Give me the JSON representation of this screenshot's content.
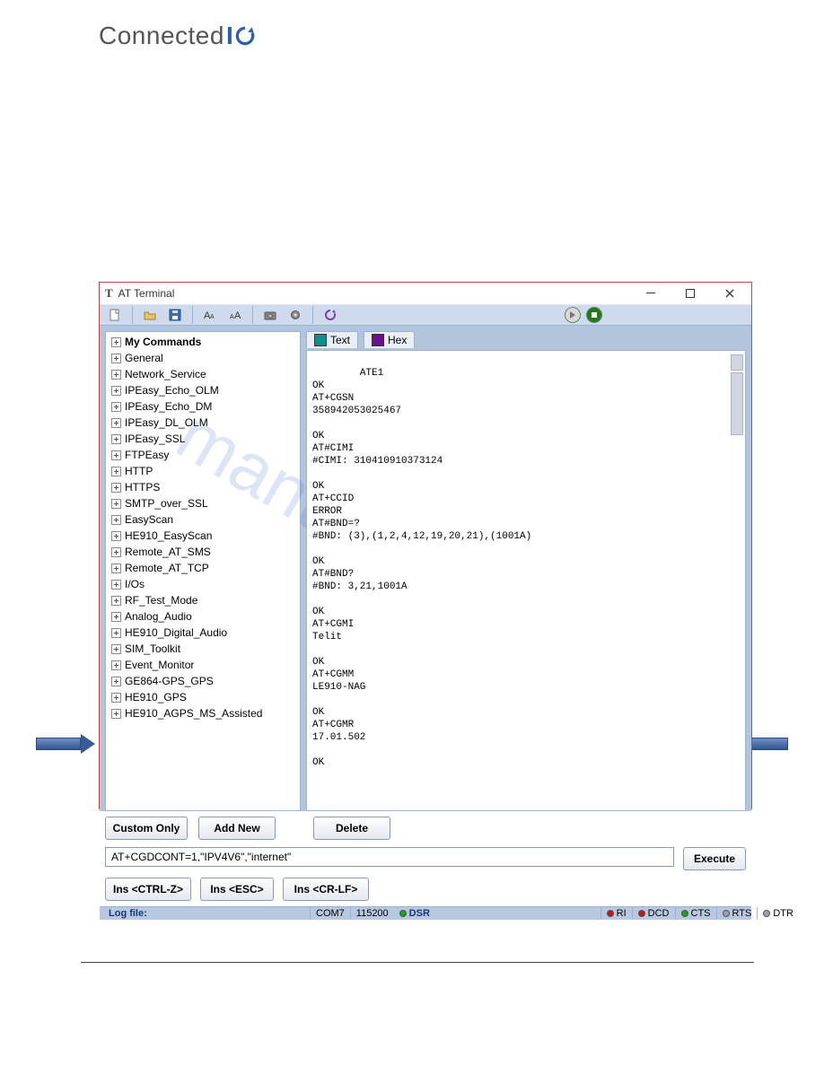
{
  "brand": {
    "text": "Connected",
    "accent": "IO"
  },
  "window": {
    "title": "AT Terminal"
  },
  "toolbar_icons": [
    "new-file-icon",
    "open-folder-icon",
    "save-icon",
    "font-larger-icon",
    "font-smaller-icon",
    "camera-icon",
    "gear-icon",
    "refresh-icon"
  ],
  "tree": [
    {
      "label": "My Commands",
      "bold": true
    },
    {
      "label": "General"
    },
    {
      "label": "Network_Service"
    },
    {
      "label": "IPEasy_Echo_OLM"
    },
    {
      "label": "IPEasy_Echo_DM"
    },
    {
      "label": "IPEasy_DL_OLM"
    },
    {
      "label": "IPEasy_SSL"
    },
    {
      "label": "FTPEasy"
    },
    {
      "label": "HTTP"
    },
    {
      "label": "HTTPS"
    },
    {
      "label": "SMTP_over_SSL"
    },
    {
      "label": "EasyScan"
    },
    {
      "label": "HE910_EasyScan"
    },
    {
      "label": "Remote_AT_SMS"
    },
    {
      "label": "Remote_AT_TCP"
    },
    {
      "label": "I/Os"
    },
    {
      "label": "RF_Test_Mode"
    },
    {
      "label": "Analog_Audio"
    },
    {
      "label": "HE910_Digital_Audio"
    },
    {
      "label": "SIM_Toolkit"
    },
    {
      "label": "Event_Monitor"
    },
    {
      "label": "GE864-GPS_GPS"
    },
    {
      "label": "HE910_GPS"
    },
    {
      "label": "HE910_AGPS_MS_Assisted"
    }
  ],
  "tabs": {
    "text": {
      "label": "Text",
      "swatch": "#0e8f8f"
    },
    "hex": {
      "label": "Hex",
      "swatch": "#6b0e8f"
    }
  },
  "terminal_text": "ATE1\nOK\nAT+CGSN\n358942053025467\n\nOK\nAT#CIMI\n#CIMI: 310410910373124\n\nOK\nAT+CCID\nERROR\nAT#BND=?\n#BND: (3),(1,2,4,12,19,20,21),(1001A)\n\nOK\nAT#BND?\n#BND: 3,21,1001A\n\nOK\nAT+CGMI\nTelit\n\nOK\nAT+CGMM\nLE910-NAG\n\nOK\nAT+CGMR\n17.01.502\n\nOK",
  "buttons": {
    "custom_only": "Custom Only",
    "add_new": "Add New",
    "delete": "Delete",
    "execute": "Execute",
    "ins_ctrlz": "Ins <CTRL-Z>",
    "ins_esc": "Ins <ESC>",
    "ins_crlf": "Ins <CR-LF>"
  },
  "command_input": "AT+CGDCONT=1,\"IPV4V6\",\"internet\"",
  "status": {
    "logfile": "Log file:",
    "port": "COM7",
    "baud": "115200",
    "signals": [
      {
        "name": "DSR",
        "color": "#18a018"
      },
      {
        "name": "RI",
        "color": "#c01515"
      },
      {
        "name": "DCD",
        "color": "#c01515"
      },
      {
        "name": "CTS",
        "color": "#18a018"
      },
      {
        "name": "RTS",
        "color": "#9aa0a8"
      },
      {
        "name": "DTR",
        "color": "#9aa0a8"
      }
    ]
  },
  "watermark": "manualshive.com"
}
